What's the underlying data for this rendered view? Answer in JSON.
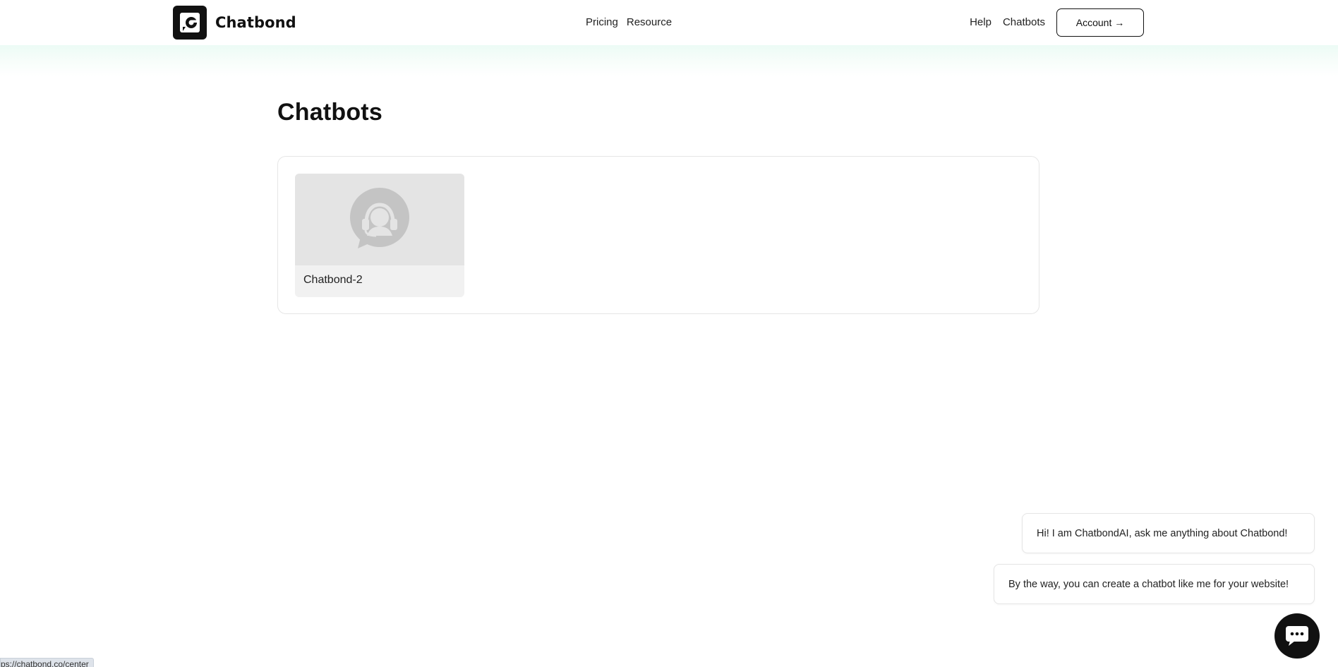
{
  "brand": {
    "name": "Chatbond"
  },
  "nav": {
    "center": [
      {
        "label": "Pricing"
      },
      {
        "label": "Resource"
      }
    ],
    "right": [
      {
        "label": "Help"
      },
      {
        "label": "Chatbots"
      }
    ],
    "account_label": "Account →"
  },
  "main": {
    "title": "Chatbots",
    "bots": [
      {
        "name": "Chatbond-2",
        "icon": "headset-chat-icon"
      }
    ]
  },
  "chat_widget": {
    "messages": [
      "Hi! I am ChatbondAI, ask me anything about Chatbond!",
      "By the way, you can create a chatbot like me for your website!"
    ],
    "launcher_icon": "chat-bubble-icon"
  },
  "status_bar": {
    "url": "ps://chatbond.co/center"
  },
  "colors": {
    "header_glow": "#ecfbf5",
    "dark": "#111111",
    "thumb_bg": "#e4e4e4",
    "icon_grey": "#c4c4c4"
  }
}
